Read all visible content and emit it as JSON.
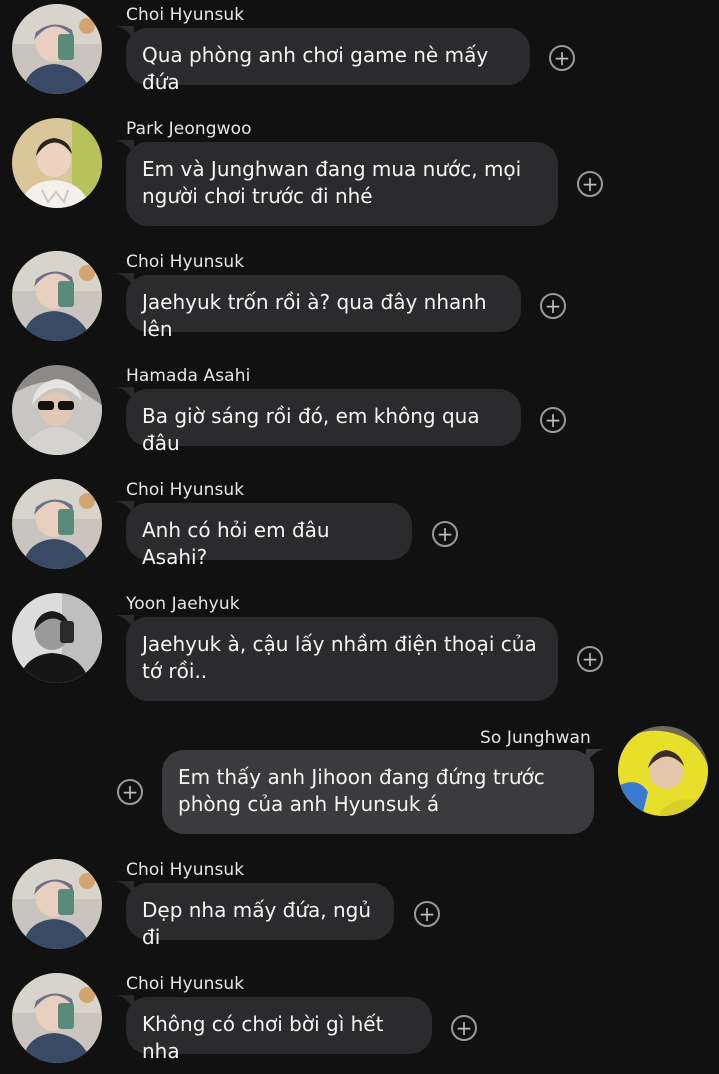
{
  "messages": [
    {
      "sender": "Choi Hyunsuk",
      "text": "Qua phòng anh chơi game nè mấy đứa",
      "avatar": "hyunsuk-avatar",
      "side": "left"
    },
    {
      "sender": "Park Jeongwoo",
      "text": "Em và Junghwan đang mua nước, mọi người chơi trước đi nhé",
      "avatar": "jeongwoo-avatar",
      "side": "left"
    },
    {
      "sender": "Choi Hyunsuk",
      "text": "Jaehyuk trốn rồi à? qua đây nhanh lên",
      "avatar": "hyunsuk-avatar",
      "side": "left"
    },
    {
      "sender": "Hamada Asahi",
      "text": "Ba giờ sáng rồi đó, em không qua đâu",
      "avatar": "asahi-avatar",
      "side": "left"
    },
    {
      "sender": "Choi Hyunsuk",
      "text": "Anh có hỏi em đâu Asahi?",
      "avatar": "hyunsuk-avatar",
      "side": "left"
    },
    {
      "sender": "Yoon Jaehyuk",
      "text": "Jaehyuk à, cậu lấy nhầm điện thoại của tớ rồi..",
      "avatar": "jaehyuk-avatar",
      "side": "left"
    },
    {
      "sender": "So Junghwan",
      "text": "Em thấy anh Jihoon đang đứng trước phòng của anh Hyunsuk á",
      "avatar": "junghwan-avatar",
      "side": "right"
    },
    {
      "sender": "Choi Hyunsuk",
      "text": "Dẹp nha mấy đứa, ngủ đi",
      "avatar": "hyunsuk-avatar",
      "side": "left"
    },
    {
      "sender": "Choi Hyunsuk",
      "text": "Không có chơi bời gì hết nha",
      "avatar": "hyunsuk-avatar",
      "side": "left"
    }
  ],
  "reaction_symbol": "+",
  "colors": {
    "background": "#111112",
    "bubble_other": "#2b2b2d",
    "bubble_mine": "#3b3b3d",
    "text": "#f4f4f4"
  }
}
